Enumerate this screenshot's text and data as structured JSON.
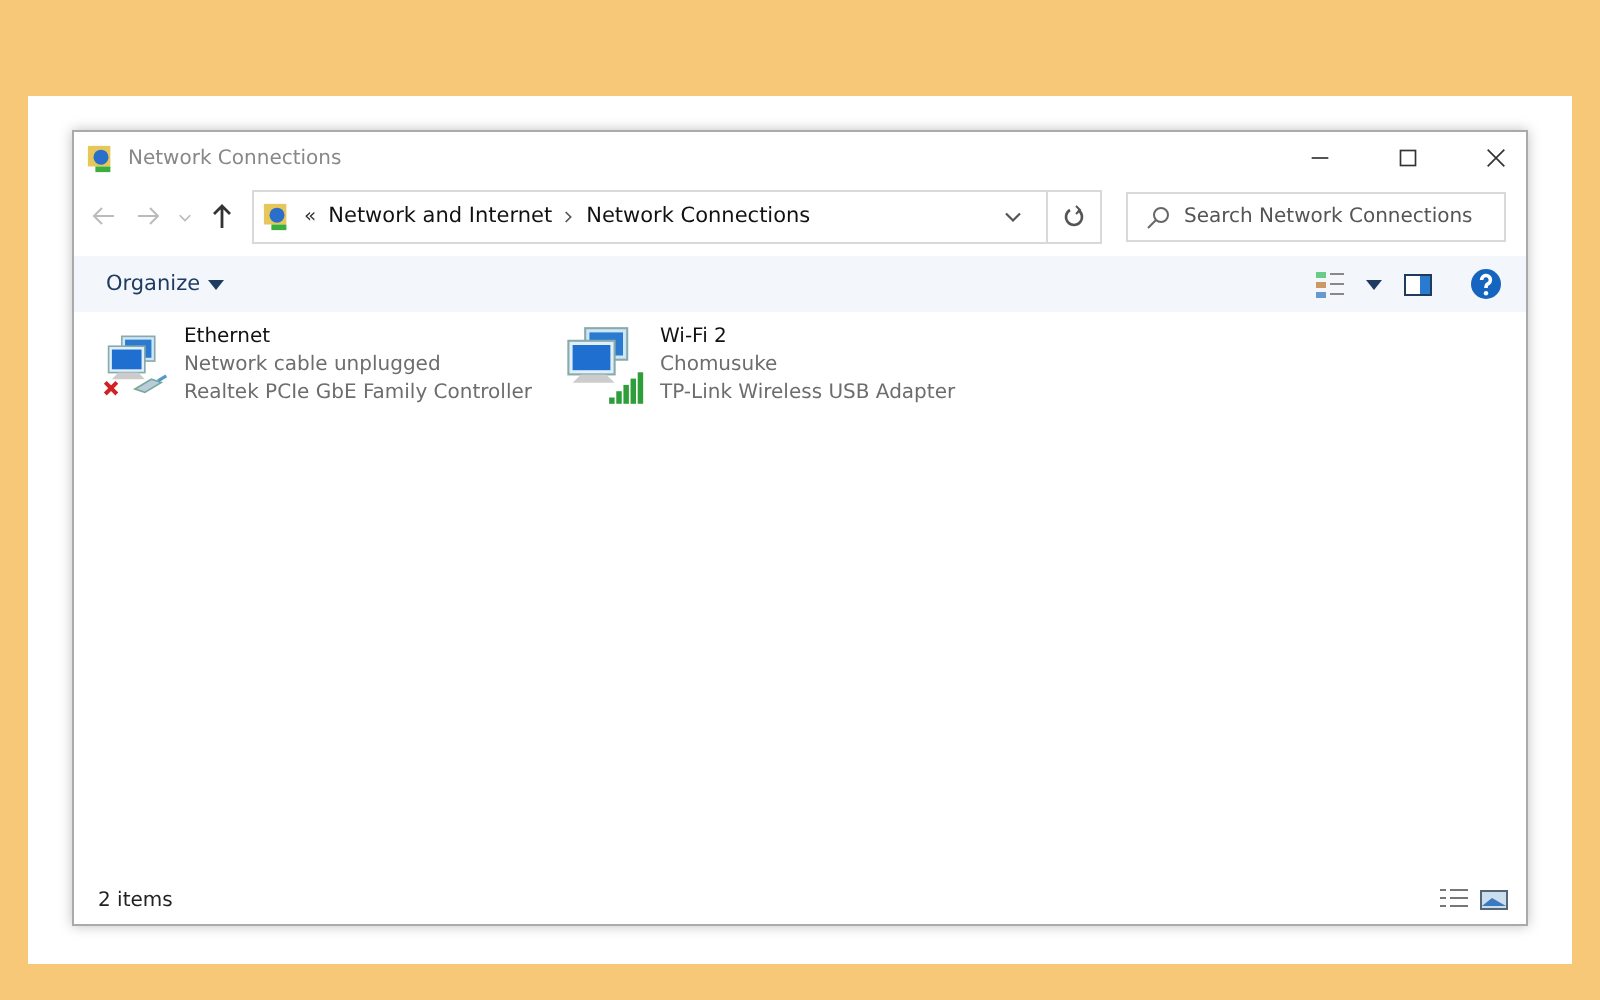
{
  "window": {
    "title": "Network Connections"
  },
  "address_bar": {
    "overflow": "«",
    "path": [
      "Network and Internet",
      "Network Connections"
    ]
  },
  "search": {
    "placeholder": "Search Network Connections"
  },
  "toolbar": {
    "organize": "Organize"
  },
  "connections": [
    {
      "kind": "ethernet",
      "connected": false,
      "name": "Ethernet",
      "status": "Network cable unplugged",
      "device": "Realtek PCIe GbE Family Controller"
    },
    {
      "kind": "wifi",
      "connected": true,
      "name": "Wi-Fi 2",
      "status": "Chomusuke",
      "device": "TP-Link Wireless USB Adapter"
    }
  ],
  "status_bar": {
    "count": "2 items"
  }
}
